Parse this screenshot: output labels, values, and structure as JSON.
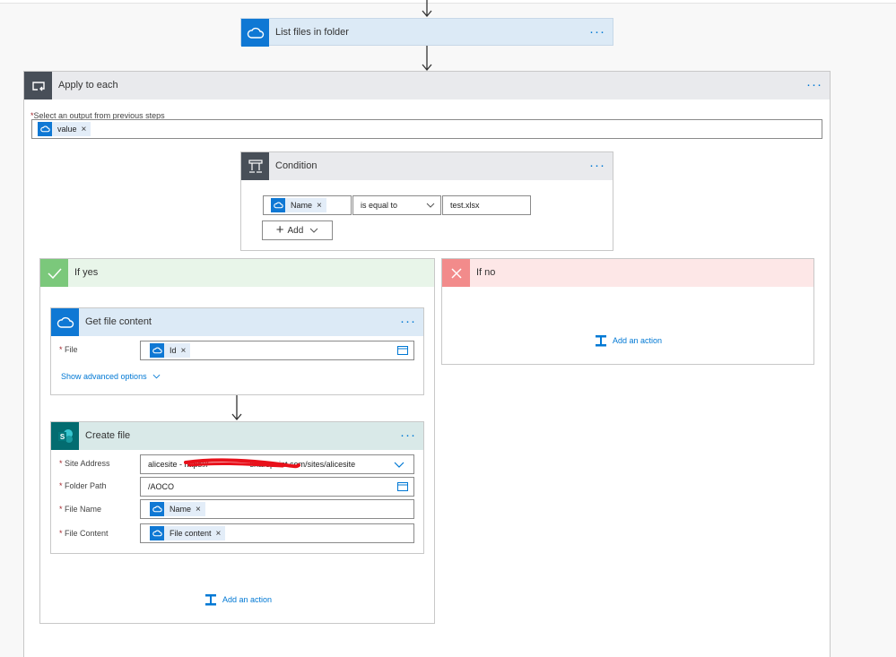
{
  "list_files": {
    "title": "List files in folder",
    "icon": "cloud-icon"
  },
  "apply_each": {
    "title": "Apply to each",
    "select_label": "Select an output from previous steps",
    "token_value": "value"
  },
  "condition": {
    "title": "Condition",
    "left_token": "Name",
    "operator": "is equal to",
    "right_value": "test.xlsx",
    "add_label": "Add"
  },
  "if_yes": {
    "title": "If yes",
    "add_action": "Add an action"
  },
  "if_no": {
    "title": "If no",
    "add_action": "Add an action"
  },
  "get_file": {
    "title": "Get file content",
    "file_label": "File",
    "file_token": "Id",
    "advanced": "Show advanced options"
  },
  "create_file": {
    "title": "Create file",
    "site_label": "Site Address",
    "site_value": "alicesite - https://",
    "site_value_end": "sharepoint.com/sites/alicesite",
    "folder_label": "Folder Path",
    "folder_value": "/AOCO",
    "name_label": "File Name",
    "name_token": "Name",
    "content_label": "File Content",
    "content_token": "File content"
  },
  "colors": {
    "accent": "#0078d4",
    "onedrive": "#0f78d4",
    "control": "#484f58",
    "sharepoint": "#036c70",
    "yes": "#5cb85c",
    "no": "#f08080"
  }
}
